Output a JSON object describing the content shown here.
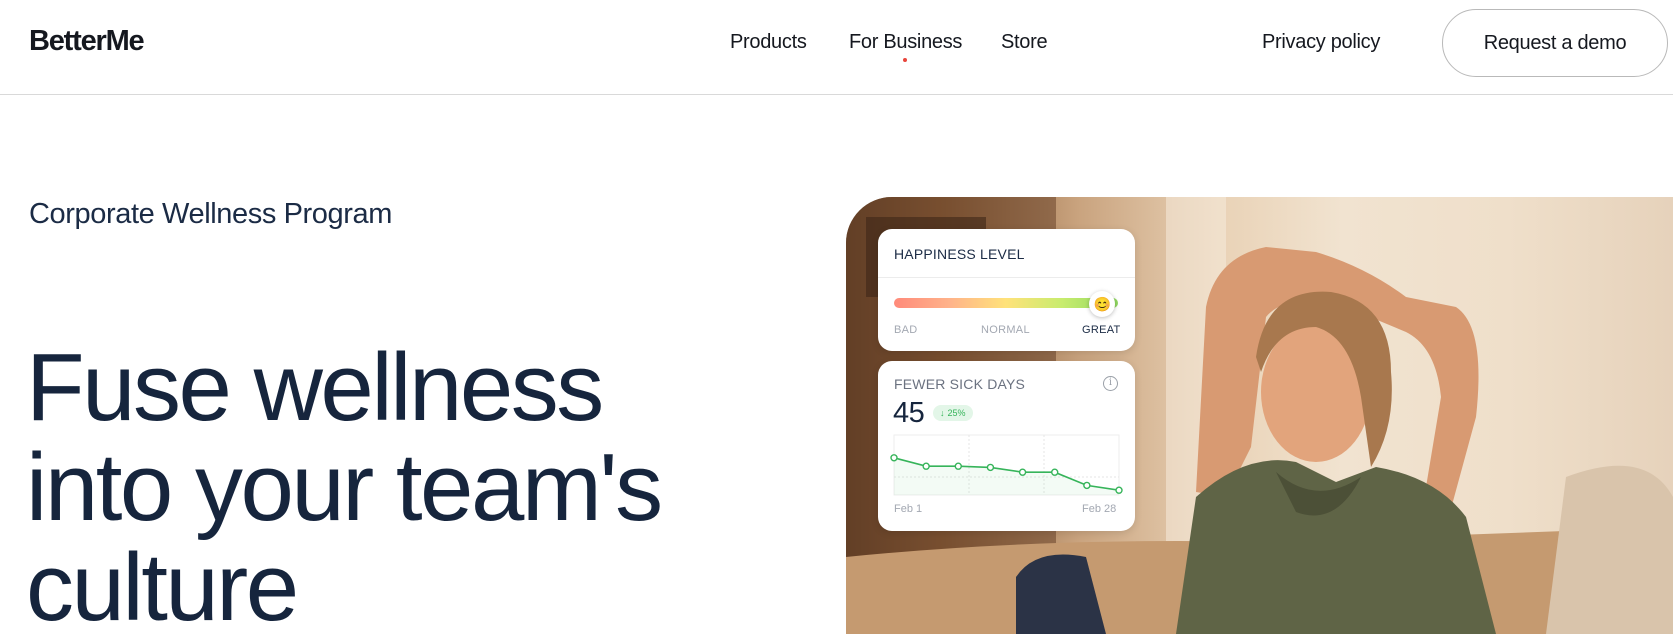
{
  "header": {
    "logo": "BetterMe",
    "nav": [
      "Products",
      "For Business",
      "Store"
    ],
    "privacy": "Privacy policy",
    "demo_button": "Request a demo",
    "accent_color": "#e8453c"
  },
  "hero": {
    "eyebrow": "Corporate Wellness Program",
    "headline_lines": [
      "Fuse wellness",
      "into your team's",
      "culture"
    ]
  },
  "happiness_card": {
    "title": "HAPPINESS LEVEL",
    "labels": [
      "BAD",
      "NORMAL",
      "GREAT"
    ],
    "knob_icon": "smiling-face-icon",
    "knob_glyph": "😊",
    "level": 0.93
  },
  "sick_days_card": {
    "title": "FEWER SICK DAYS",
    "value": "45",
    "badge_icon": "arrow-down-icon",
    "badge": "25%",
    "x_start": "Feb 1",
    "x_end": "Feb 28",
    "line_color": "#36b45a"
  },
  "chart_data": {
    "type": "line",
    "title": "FEWER SICK DAYS",
    "x": [
      "Feb 1",
      "",
      "",
      "",
      "",
      "",
      "",
      "Feb 28"
    ],
    "series": [
      {
        "values": [
          62,
          48,
          48,
          46,
          38,
          38,
          16,
          8
        ]
      }
    ],
    "ylim": [
      0,
      100
    ],
    "grid": true
  }
}
